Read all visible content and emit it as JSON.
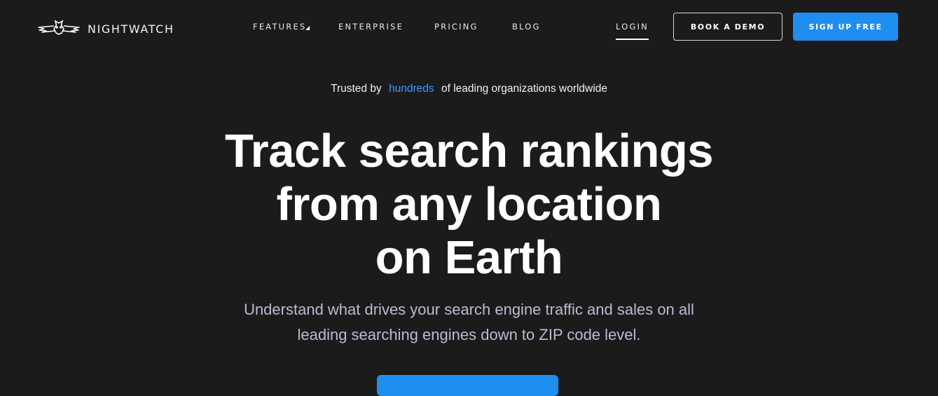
{
  "brand": {
    "name": "NIGHTWATCH",
    "logo_icon": "owl-icon"
  },
  "nav": {
    "links": [
      {
        "label": "FEATURES"
      },
      {
        "label": "ENTERPRISE"
      },
      {
        "label": "PRICING"
      },
      {
        "label": "BLOG"
      }
    ],
    "login": "LOGIN",
    "book_demo": "BOOK A DEMO",
    "signup": "SIGN UP FREE"
  },
  "hero": {
    "trusted_prefix": "Trusted by",
    "trusted_highlight": "hundreds",
    "trusted_suffix": "of leading organizations worldwide",
    "headline_lines": [
      "Track search rankings",
      "from any location",
      "on Earth"
    ],
    "subtitle_lines": [
      "Understand what drives your search engine traffic and sales on all",
      "leading searching engines down to ZIP code level."
    ]
  },
  "colors": {
    "background": "#1b1b1c",
    "accent": "#1f8ef1",
    "highlight": "#3d97ff",
    "subtitle": "#b9bdd2"
  }
}
